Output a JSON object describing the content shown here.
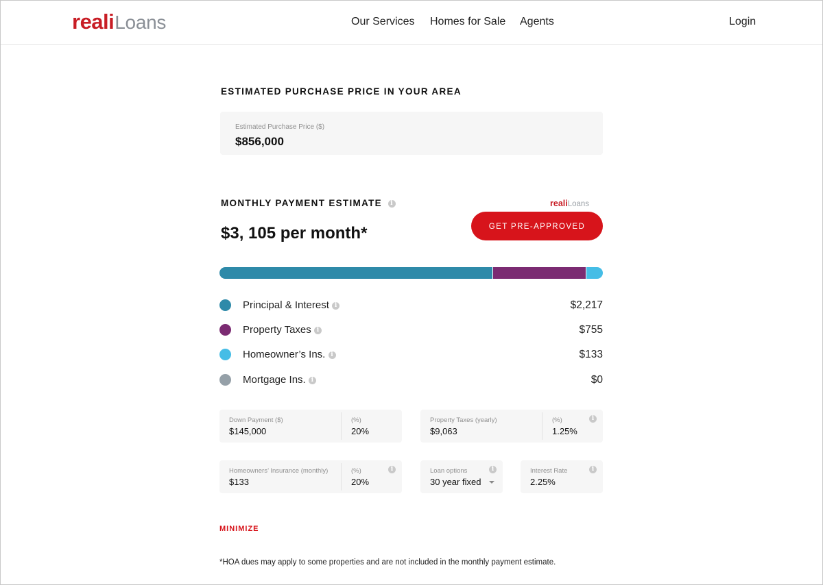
{
  "header": {
    "logo_brand": "reali",
    "logo_sub": "Loans",
    "nav": [
      "Our Services",
      "Homes for Sale",
      "Agents"
    ],
    "login": "Login"
  },
  "purchase": {
    "title": "ESTIMATED PURCHASE PRICE IN YOUR AREA",
    "field_label": "Estimated Purchase Price ($)",
    "field_value": "$856,000"
  },
  "payment": {
    "title": "MONTHLY PAYMENT ESTIMATE",
    "logo_brand": "reali",
    "logo_sub": "Loans",
    "cta": "GET PRE-APPROVED",
    "monthly": "$3, 105 per month*"
  },
  "breakdown": [
    {
      "name": "Principal & Interest",
      "amount": "$2,217",
      "value": 2217,
      "color": "#2e8aa9"
    },
    {
      "name": "Property Taxes",
      "amount": "$755",
      "value": 755,
      "color": "#7b2b72"
    },
    {
      "name": "Homeowner’s Ins.",
      "amount": "$133",
      "value": 133,
      "color": "#45bde6"
    },
    {
      "name": "Mortgage Ins.",
      "amount": "$0",
      "value": 0,
      "color": "#95a0a8"
    }
  ],
  "inputs": {
    "down_payment": {
      "label": "Down Payment ($)",
      "value": "$145,000",
      "pct_label": "(%)",
      "pct_value": "20%"
    },
    "property_taxes": {
      "label": "Property Taxes (yearly)",
      "value": "$9,063",
      "pct_label": "(%)",
      "pct_value": "1.25%"
    },
    "insurance": {
      "label": "Homeowners’ Insurance (monthly)",
      "value": "$133",
      "pct_label": "(%)",
      "pct_value": "20%"
    },
    "loan_options": {
      "label": "Loan options",
      "value": "30 year fixed"
    },
    "interest_rate": {
      "label": "Interest Rate",
      "value": "2.25%"
    }
  },
  "info_glyph": "i",
  "minimize": "MINIMIZE",
  "footnote": "*HOA dues may apply to some properties and are not included in the monthly payment estimate."
}
